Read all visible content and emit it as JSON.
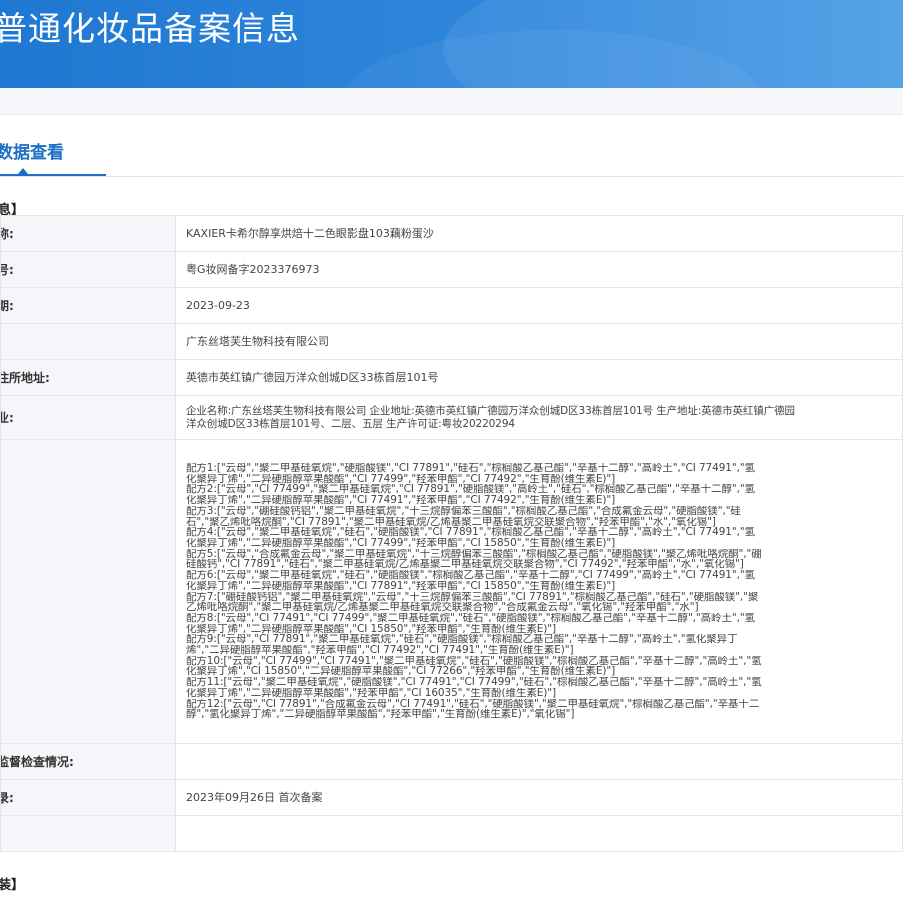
{
  "banner": {
    "title": "普通化妆品备案信息"
  },
  "tabs": {
    "active": "数据查看"
  },
  "section": {
    "title": "息】"
  },
  "rows": [
    {
      "key": "称:",
      "value": "KAXIER卡希尔醇享烘焙十二色眼影盘103藕粉蛋沙"
    },
    {
      "key": "号:",
      "value": "粤G妆网备字2023376973"
    },
    {
      "key": "期:",
      "value": "2023-09-23"
    },
    {
      "key": ":",
      "value": "广东丝塔芙生物科技有限公司"
    },
    {
      "key": "住所地址:",
      "value": "英德市英红镇广德园万洋众创城D区33栋首层101号"
    },
    {
      "key": "业:",
      "value_lines": [
        "企业名称:广东丝塔芙生物科技有限公司 企业地址:英德市英红镇广德园万洋众创城D区33栋首层101号 生产地址:英德市英红镇广德园",
        "洋众创城D区33栋首层101号、二层、五层 生产许可证:粤妆20220294"
      ]
    },
    {
      "key": "",
      "formula_lines": [
        "配方1:[\"云母\",\"聚二甲基硅氧烷\",\"硬脂酸镁\",\"CI 77891\",\"硅石\",\"棕榈酸乙基己酯\",\"辛基十二醇\",\"高岭土\",\"CI 77491\",\"氢",
        "化聚异丁烯\",\"二异硬脂醇苹果酸酯\",\"CI 77499\",\"羟苯甲酯\",\"CI 77492\",\"生育酚(维生素E)\"]",
        "配方2:[\"云母\",\"CI 77499\",\"聚二甲基硅氧烷\",\"CI 77891\",\"硬脂酸镁\",\"高岭土\",\"硅石\",\"棕榈酸乙基己酯\",\"辛基十二醇\",\"氢",
        "化聚异丁烯\",\"二异硬脂醇苹果酸酯\",\"CI 77491\",\"羟苯甲酯\",\"CI 77492\",\"生育酚(维生素E)\"]",
        "配方3:[\"云母\",\"硼硅酸钙铝\",\"聚二甲基硅氧烷\",\"十三烷醇偏苯三酸酯\",\"棕榈酸乙基己酯\",\"合成氟金云母\",\"硬脂酸镁\",\"硅",
        "石\",\"聚乙烯吡咯烷酮\",\"CI 77891\",\"聚二甲基硅氧烷/乙烯基聚二甲基硅氧烷交联聚合物\",\"羟苯甲酯\",\"水\",\"氧化锡\"]",
        "配方4:[\"云母\",\"聚二甲基硅氧烷\",\"硅石\",\"硬脂酸镁\",\"CI 77891\",\"棕榈酸乙基己酯\",\"辛基十二醇\",\"高岭土\",\"CI 77491\",\"氢",
        "化聚异丁烯\",\"二异硬脂醇苹果酸酯\",\"CI 77499\",\"羟苯甲酯\",\"CI 15850\",\"生育酚(维生素E)\"]",
        "配方5:[\"云母\",\"合成氟金云母\",\"聚二甲基硅氧烷\",\"十三烷醇偏苯三酸酯\",\"棕榈酸乙基己酯\",\"硬脂酸镁\",\"聚乙烯吡咯烷酮\",\"硼",
        "硅酸钙\",\"CI 77891\",\"硅石\",\"聚二甲基硅氧烷/乙烯基聚二甲基硅氧烷交联聚合物\",\"CI 77492\",\"羟苯甲酯\",\"水\",\"氧化锡\"]",
        "配方6:[\"云母\",\"聚二甲基硅氧烷\",\"硅石\",\"硬脂酸镁\",\"棕榈酸乙基己酯\",\"辛基十二醇\",\"CI 77499\",\"高岭土\",\"CI 77491\",\"氢",
        "化聚异丁烯\",\"二异硬脂醇苹果酸酯\",\"CI 77891\",\"羟苯甲酯\",\"CI 15850\",\"生育酚(维生素E)\"]",
        "配方7:[\"硼硅酸钙铝\",\"聚二甲基硅氧烷\",\"云母\",\"十三烷醇偏苯三酸酯\",\"CI 77891\",\"棕榈酸乙基己酯\",\"硅石\",\"硬脂酸镁\",\"聚",
        "乙烯吡咯烷酮\",\"聚二甲基硅氧烷/乙烯基聚二甲基硅氧烷交联聚合物\",\"合成氟金云母\",\"氧化锡\",\"羟苯甲酯\",\"水\"]",
        "配方8:[\"云母\",\"CI 77491\",\"CI 77499\",\"聚二甲基硅氧烷\",\"硅石\",\"硬脂酸镁\",\"棕榈酸乙基己酯\",\"辛基十二醇\",\"高岭土\",\"氢",
        "化聚异丁烯\",\"二异硬脂醇苹果酸酯\",\"CI 15850\",\"羟苯甲酯\",\"生育酚(维生素E)\"]",
        "配方9:[\"云母\",\"CI 77891\",\"聚二甲基硅氧烷\",\"硅石\",\"硬脂酸镁\",\"棕榈酸乙基己酯\",\"辛基十二醇\",\"高岭土\",\"氢化聚异丁",
        "烯\",\"二异硬脂醇苹果酸酯\",\"羟苯甲酯\",\"CI 77492\",\"CI 77491\",\"生育酚(维生素E)\"]",
        "配方10:[\"云母\",\"CI 77499\",\"CI 77491\",\"聚二甲基硅氧烷\",\"硅石\",\"硬脂酸镁\",\"棕榈酸乙基己酯\",\"辛基十二醇\",\"高岭土\",\"氢",
        "化聚异丁烯\",\"CI 15850\",\"二异硬脂醇苹果酸酯\",\"CI 77266\",\"羟苯甲酯\",\"生育酚(维生素E)\"]",
        "配方11:[\"云母\",\"聚二甲基硅氧烷\",\"硬脂酸镁\",\"CI 77491\",\"CI 77499\",\"硅石\",\"棕榈酸乙基己酯\",\"辛基十二醇\",\"高岭土\",\"氢",
        "化聚异丁烯\",\"二异硬脂醇苹果酸酯\",\"羟苯甲酯\",\"CI 16035\",\"生育酚(维生素E)\"]",
        "配方12:[\"云母\",\"CI 77891\",\"合成氟金云母\",\"CI 77491\",\"硅石\",\"硬脂酸镁\",\"聚二甲基硅氧烷\",\"棕榈酸乙基己酯\",\"辛基十二",
        "醇\",\"氢化聚异丁烯\",\"二异硬脂醇苹果酸酯\",\"羟苯甲酯\",\"生育酚(维生素E)\",\"氧化锡\"]"
      ]
    },
    {
      "key": "监督检查情况:",
      "value": ""
    },
    {
      "key": "录:",
      "value": "2023年09月26日 首次备案"
    },
    {
      "key": "",
      "value": ""
    }
  ],
  "bottom": {
    "title": "装】"
  }
}
